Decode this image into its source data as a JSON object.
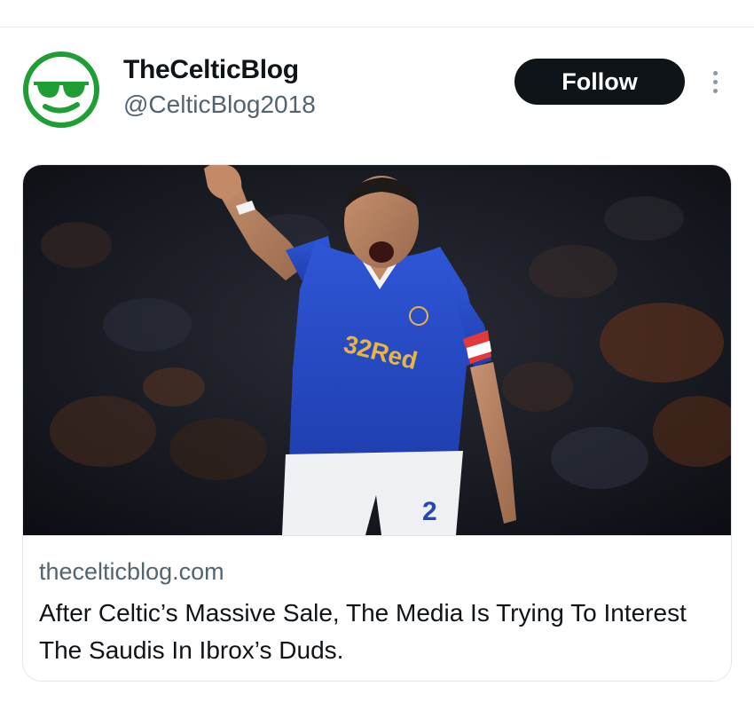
{
  "tweet": {
    "author": {
      "display_name": "TheCelticBlog",
      "handle": "@CelticBlog2018",
      "avatar_icon": "sunglasses-face-icon",
      "avatar_color": "#1e9e34"
    },
    "follow_label": "Follow",
    "more_icon": "more-options-icon"
  },
  "link_card": {
    "image": "footballer-in-blue-kit-photo",
    "shirt_sponsor": "32Red",
    "shirt_number": "2",
    "domain": "thecelticblog.com",
    "title": "After Celtic’s Massive Sale, The Media Is Trying To Interest The Saudis In Ibrox’s Duds."
  },
  "colors": {
    "text_primary": "#0f1419",
    "text_secondary": "#536471",
    "follow_bg": "#0f1419",
    "border": "#e1e6ea"
  }
}
